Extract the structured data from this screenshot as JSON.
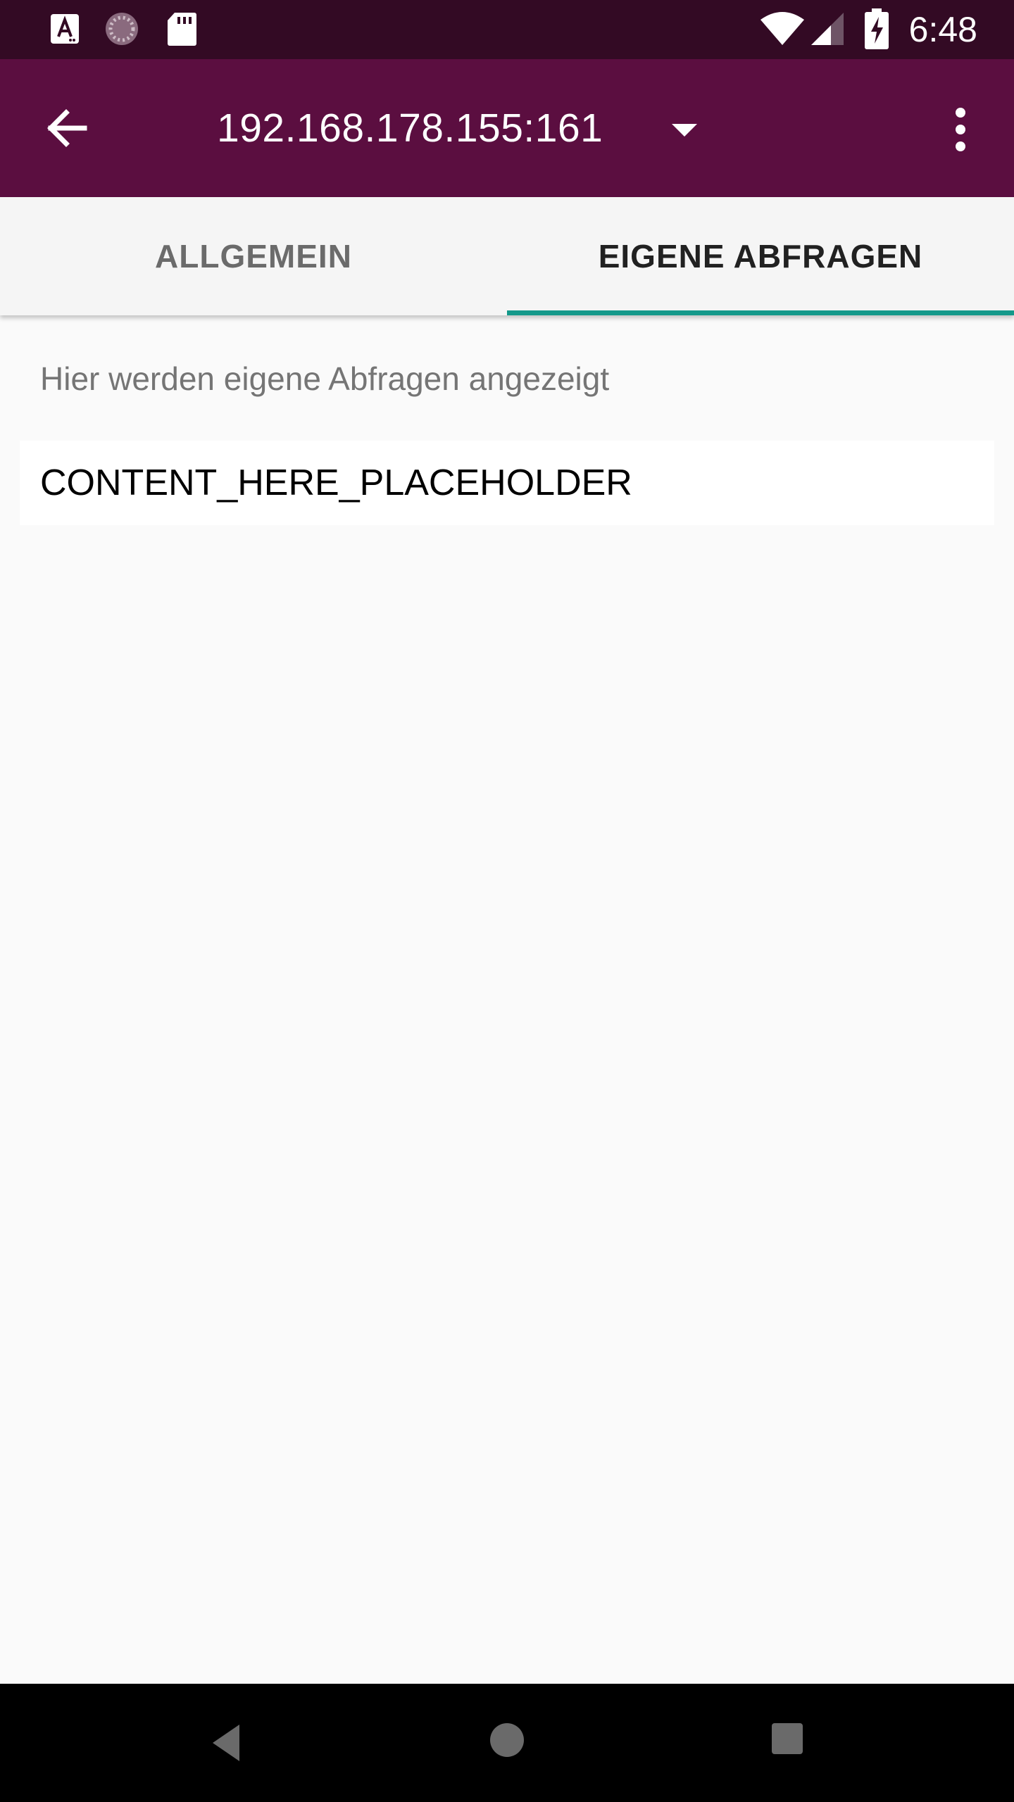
{
  "status_bar": {
    "time": "6:48",
    "left_icons": [
      "text-app-icon",
      "loading-circle-icon",
      "sd-card-icon"
    ],
    "right_icons": [
      "wifi-icon",
      "cell-signal-icon",
      "battery-charging-icon"
    ]
  },
  "app_bar": {
    "title": "192.168.178.155:161",
    "background": "#5b0e40",
    "icons": {
      "back": "arrow-back-icon",
      "dropdown": "dropdown-arrow-icon",
      "more": "more-vert-icon"
    }
  },
  "tabs": [
    {
      "label": "ALLGEMEIN",
      "selected": false
    },
    {
      "label": "EIGENE ABFRAGEN",
      "selected": true
    }
  ],
  "tab_indicator_color": "#14998a",
  "content": {
    "hint": "Hier werden eigene Abfragen angezeigt",
    "items": [
      "CONTENT_HERE_PLACEHOLDER"
    ]
  },
  "nav_bar": {
    "icons": [
      "back-triangle-icon",
      "home-circle-icon",
      "recents-square-icon"
    ]
  }
}
